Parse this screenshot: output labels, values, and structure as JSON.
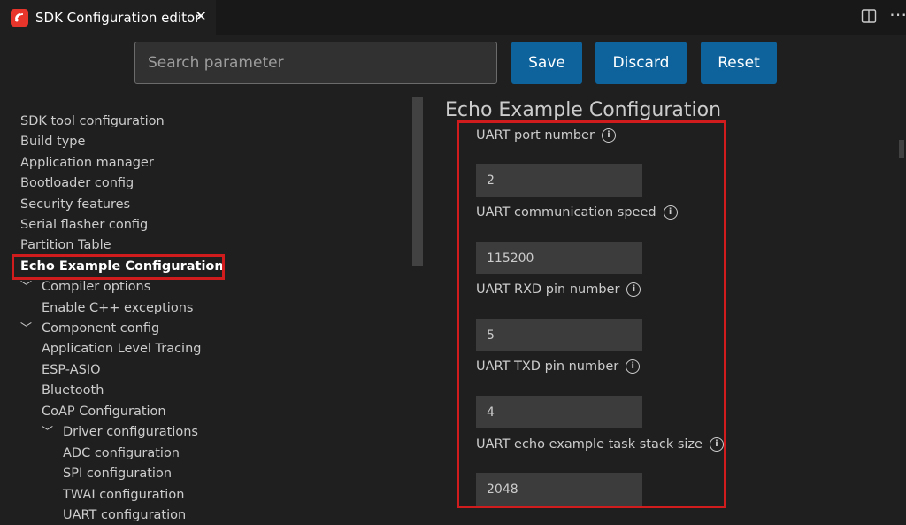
{
  "tab": {
    "title": "SDK Configuration editor",
    "close": "✕",
    "icon": "espressif-logo-icon"
  },
  "toolbar": {
    "search_placeholder": "Search parameter",
    "save_label": "Save",
    "discard_label": "Discard",
    "reset_label": "Reset"
  },
  "tree": {
    "items": [
      {
        "label": "SDK tool configuration",
        "level": 0
      },
      {
        "label": "Build type",
        "level": 0
      },
      {
        "label": "Application manager",
        "level": 0
      },
      {
        "label": "Bootloader config",
        "level": 0
      },
      {
        "label": "Security features",
        "level": 0
      },
      {
        "label": "Serial flasher config",
        "level": 0
      },
      {
        "label": "Partition Table",
        "level": 0
      },
      {
        "label": "Echo Example Configuration",
        "level": 0,
        "selected": true
      },
      {
        "label": "Compiler options",
        "level": 0,
        "expanded": true
      },
      {
        "label": "Enable C++ exceptions",
        "level": 1
      },
      {
        "label": "Component config",
        "level": 0,
        "expanded": true
      },
      {
        "label": "Application Level Tracing",
        "level": 1
      },
      {
        "label": "ESP-ASIO",
        "level": 1
      },
      {
        "label": "Bluetooth",
        "level": 1
      },
      {
        "label": "CoAP Configuration",
        "level": 1
      },
      {
        "label": "Driver configurations",
        "level": 1,
        "expanded": true
      },
      {
        "label": "ADC configuration",
        "level": 2
      },
      {
        "label": "SPI configuration",
        "level": 2
      },
      {
        "label": "TWAI configuration",
        "level": 2
      },
      {
        "label": "UART configuration",
        "level": 2
      }
    ]
  },
  "section": {
    "title": "Echo Example Configuration",
    "fields": [
      {
        "label": "UART port number",
        "value": "2"
      },
      {
        "label": "UART communication speed",
        "value": "115200"
      },
      {
        "label": "UART RXD pin number",
        "value": "5"
      },
      {
        "label": "UART TXD pin number",
        "value": "4"
      },
      {
        "label": "UART echo example task stack size",
        "value": "2048"
      }
    ]
  },
  "colors": {
    "accent": "#0e639c",
    "highlight": "#d01c1c",
    "background": "#1f1f1f"
  }
}
